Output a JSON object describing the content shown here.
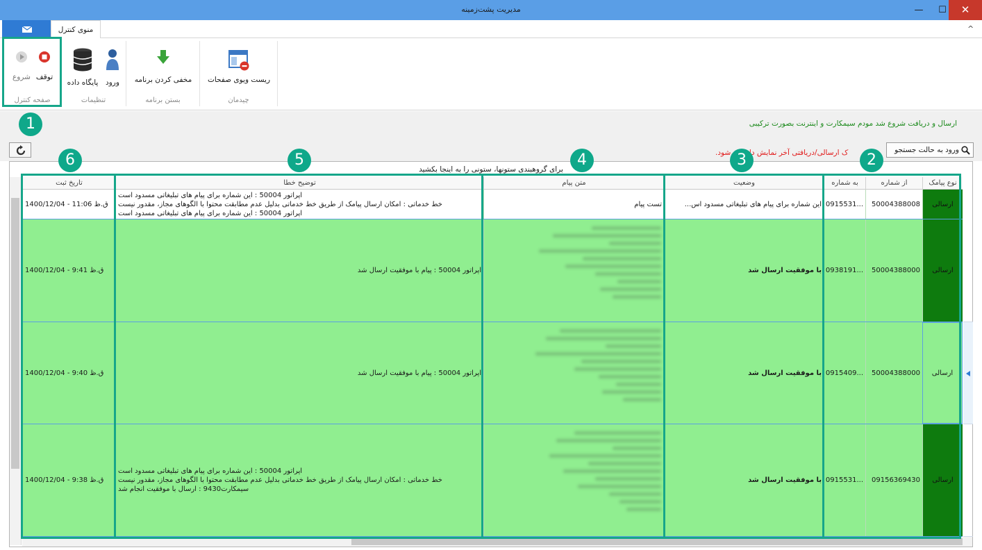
{
  "window": {
    "title": "مدیریت پشت‌زمینه",
    "min": "—",
    "max": "☐",
    "close": "✕"
  },
  "tabs": {
    "control": "منوی کنترل",
    "collapse": "^"
  },
  "ribbon": {
    "groups": {
      "control_page": "صفحه کنترل",
      "settings": "تنظیمات",
      "close_app": "بستن برنامه",
      "layout": "چیدمان"
    },
    "buttons": {
      "stop": "توقف",
      "start": "شروع",
      "database": "پایگاه داده",
      "login": "ورود",
      "hide_app": "مخفی کردن برنامه",
      "reset_views": "ریست ویوی صفحات"
    }
  },
  "status": {
    "message": "ارسال و دریافت شروع شد مودم سیمکارت و اینترنت بصورت ترکیبی",
    "warning": "ک ارسالی/دریافتی آخر نمایش دا ...   ...شود.",
    "search_button": "ورود به حالت جستجو"
  },
  "grid": {
    "group_panel": "برای گروهبندی ستونها، ستونی را به اینجا بکشید",
    "headers": {
      "type": "نوع پیامک",
      "from": "از شماره",
      "to": "به شماره",
      "status": "وضعیت",
      "text": "متن پیام",
      "error": "توضیح خطا",
      "date": "تاریخ ثبت"
    },
    "rows": [
      {
        "type": "ارسالی",
        "from": "50004388008",
        "to": "0915531...",
        "status": "این شماره برای پیام های تبلیغاتی مسدود اس...",
        "text": "تست پیام",
        "error": [
          "اپراتور 50004 : این شماره برای پیام های تبلیغاتی مسدود است",
          "خط خدماتی : امکان ارسال پیامک از طریق خط خدماتی بدلیل عدم مطابقت محتوا با الگوهای مجاز، مقدور نیست",
          "اپراتور 50004 : این شماره برای پیام های تبلیغاتی مسدود است"
        ],
        "date": "1400/12/04 - 11:06 ق.ظ"
      },
      {
        "type": "ارسالی",
        "from": "50004388000",
        "to": "0938191...",
        "status": "با موفقیت ارسال شد",
        "text": "",
        "error": [
          "اپراتور 50004 : پیام با موفقیت ارسال شد"
        ],
        "date": "1400/12/04 - 9:41 ق.ظ"
      },
      {
        "type": "ارسالی",
        "from": "50004388000",
        "to": "0915409...",
        "status": "با موفقیت ارسال شد",
        "text": "",
        "error": [
          "اپراتور 50004 : پیام با موفقیت ارسال شد"
        ],
        "date": "1400/12/04 - 9:40 ق.ظ"
      },
      {
        "type": "ارسالی",
        "from": "09156369430",
        "to": "0915531...",
        "status": "با موفقیت ارسال شد",
        "text": "",
        "error": [
          "اپراتور 50004 : این شماره برای پیام های تبلیغاتی مسدود است",
          "خط خدماتی : امکان ارسال پیامک از طریق خط خدماتی بدلیل عدم مطابقت محتوا با الگوهای مجاز، مقدور نیست",
          "سیمکارت9430 : ارسال با موفقیت انجام شد"
        ],
        "date": "1400/12/04 - 9:38 ق.ظ"
      }
    ]
  },
  "annotations": [
    "1",
    "2",
    "3",
    "4",
    "5",
    "6"
  ],
  "colors": {
    "accent": "#16a68a",
    "row_green": "#90ee90",
    "type_green": "#0e7b0e",
    "titlebar": "#5a9ee6"
  }
}
